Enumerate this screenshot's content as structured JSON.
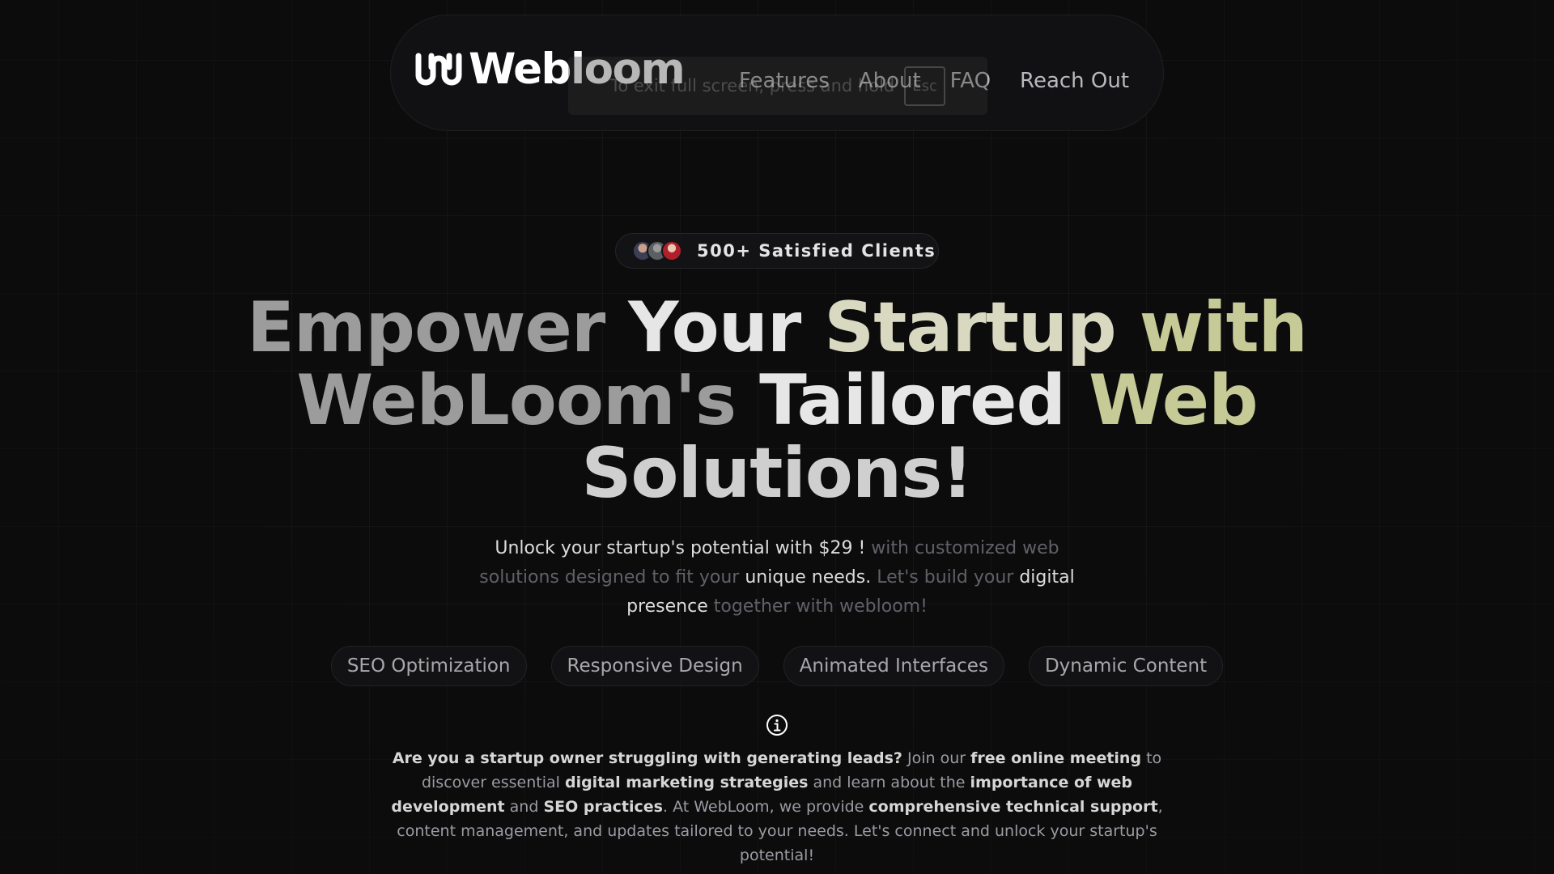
{
  "nav": {
    "brand": "Webloom",
    "links": [
      "Features",
      "About",
      "FAQ",
      "Reach Out"
    ]
  },
  "fullscreen_notice": {
    "text": "To exit full screen, press and hold",
    "key": "Esc"
  },
  "badge": {
    "text": "500+ Satisfied Clients"
  },
  "headline": {
    "w1": "Empower",
    "w2": "Your",
    "w3": "Startup",
    "w4": "with",
    "w5": "WebLoom's",
    "w6": "Tailored",
    "w7": "Web",
    "w8": "Solutions!"
  },
  "subtext": {
    "p1": "Unlock your startup's potential with $29 !",
    "p2": " with customized web solutions designed to fit your ",
    "p3": "unique needs.",
    "p4": " Let's build your ",
    "p5": "digital presence",
    "p6": " together with webloom!"
  },
  "chips": [
    "SEO Optimization",
    "Responsive Design",
    "Animated Interfaces",
    "Dynamic Content"
  ],
  "paragraph": {
    "s1": "Are you a startup owner struggling with generating leads?",
    "s2": " Join our ",
    "s3": "free online meeting",
    "s4": " to discover essential ",
    "s5": "digital marketing strategies",
    "s6": " and learn about the ",
    "s7": "importance of web development",
    "s8": " and ",
    "s9": "SEO practices",
    "s10": ". At WebLoom, we provide ",
    "s11": "comprehensive technical support",
    "s12": ", content management, and updates tailored to your needs. Let's connect and unlock your startup's potential!"
  },
  "colors": {
    "background": "#0c0c0d",
    "accent_olive": "#c6ca96",
    "text_primary": "#e6e6e6",
    "text_muted": "#5f6167"
  },
  "icons": {
    "logo": "webloom-logo-icon",
    "info": "info-icon"
  }
}
